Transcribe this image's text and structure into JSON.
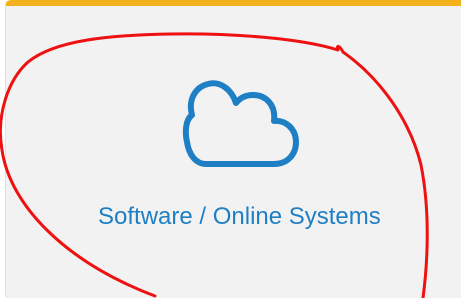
{
  "card": {
    "label": "Software / Online Systems",
    "icon": "cloud-icon",
    "accent_color": "#f3b21b",
    "label_color": "#1f7fc4",
    "icon_color": "#1f7fc4",
    "background_color": "#f2f2f2"
  },
  "annotation": {
    "kind": "hand-drawn circle",
    "color": "#ee1111"
  }
}
